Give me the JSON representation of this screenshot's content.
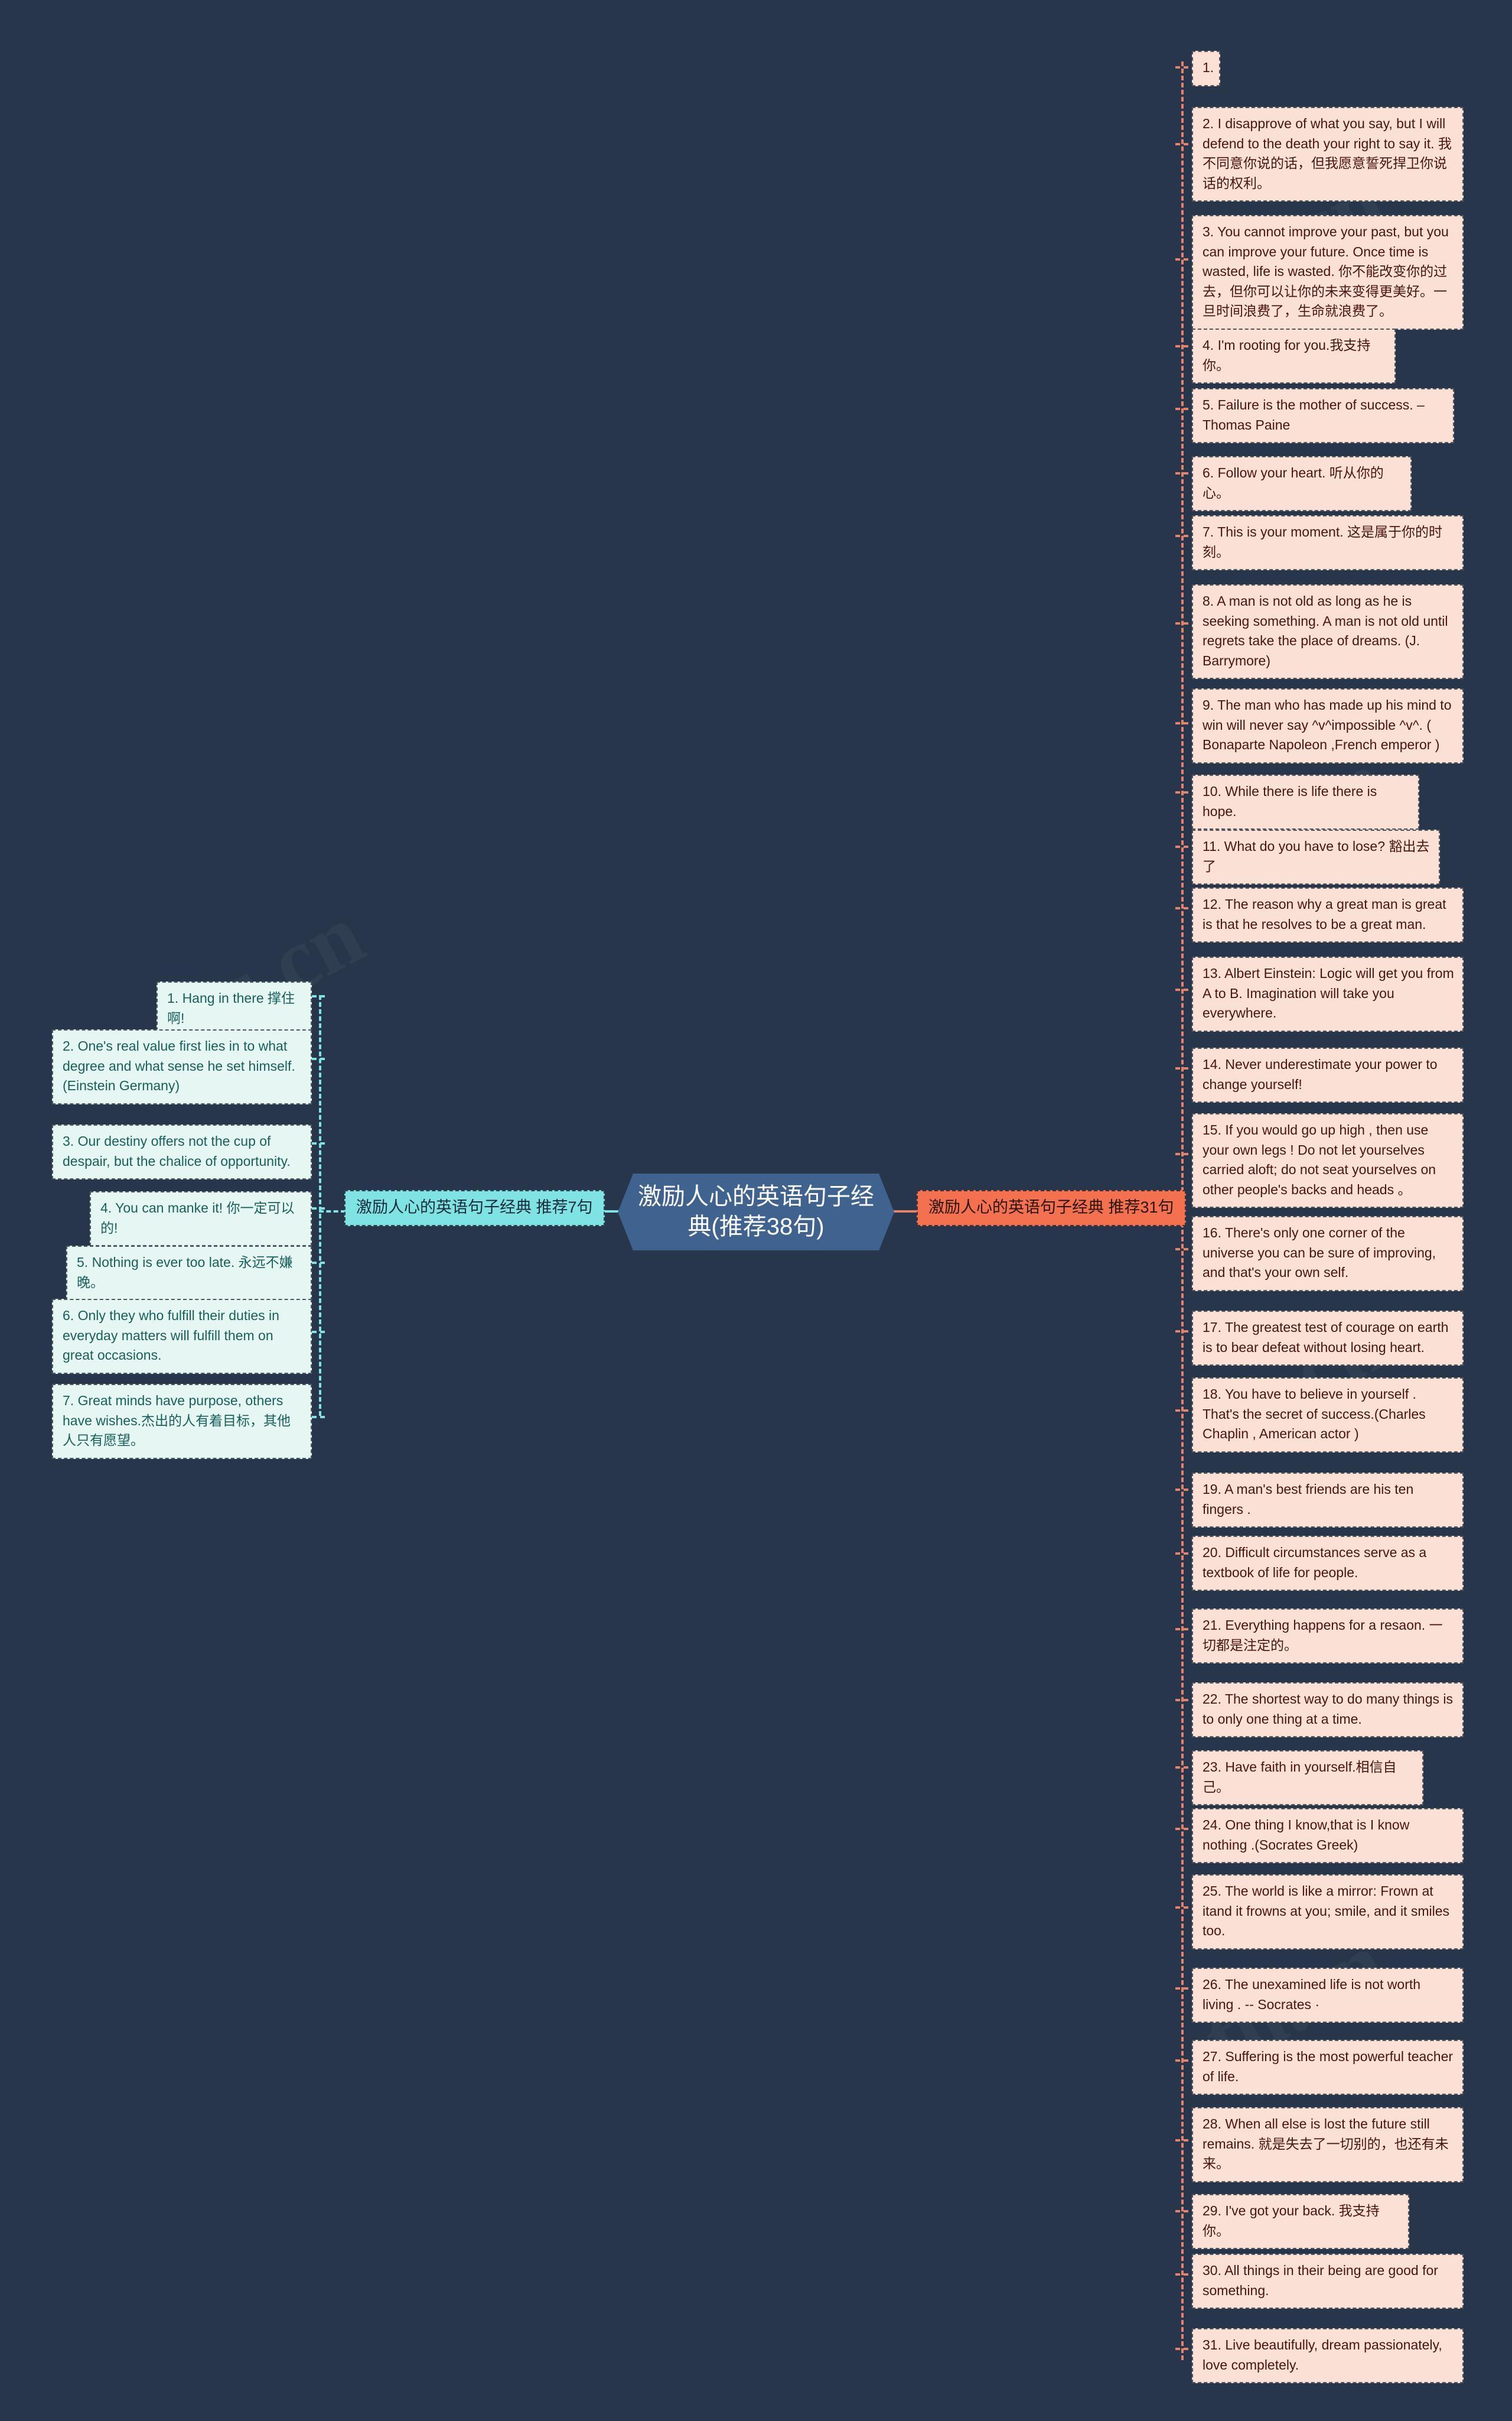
{
  "theme": {
    "canvas_bg": "#27364b",
    "root_bg": "#40628f",
    "root_text": "#ffffff",
    "left_branch_bg": "#7fe3e3",
    "right_branch_bg": "#f4714f",
    "left_leaf_bg": "#e6f7f3",
    "left_leaf_text": "#18605c",
    "right_leaf_bg": "#fbe0d5",
    "right_leaf_text": "#4a1412",
    "left_line": "#7fe3e3",
    "right_line": "#e4836c"
  },
  "root": {
    "label": "激励人心的英语句子经典(推荐38句)"
  },
  "branches": [
    {
      "side": "left",
      "label": "激励人心的英语句子经典 推荐7句",
      "leaves": [
        {
          "text": "1. Hang in there 撑住啊!"
        },
        {
          "text": "2. One's real value first lies in to what degree and what sense he set himself.(Einstein Germany)"
        },
        {
          "text": "3. Our destiny offers not the cup of despair, but the chalice of opportunity."
        },
        {
          "text": "4. You can manke it! 你一定可以的!"
        },
        {
          "text": "5. Nothing is ever too late. 永远不嫌晚。"
        },
        {
          "text": "6. Only they who fulfill their duties in everyday matters will fulfill them on great occasions."
        },
        {
          "text": "7. Great minds have purpose, others have wishes.杰出的人有着目标，其他人只有愿望。"
        }
      ]
    },
    {
      "side": "right",
      "label": "激励人心的英语句子经典 推荐31句",
      "leaves": [
        {
          "text": "1."
        },
        {
          "text": "2. I disapprove of what you say, but I will defend to the death your right to say it. 我不同意你说的话，但我愿意誓死捍卫你说话的权利。"
        },
        {
          "text": "3. You cannot improve your past, but you can improve your future. Once time is wasted, life is wasted. 你不能改变你的过去，但你可以让你的未来变得更美好。一旦时间浪费了，生命就浪费了。"
        },
        {
          "text": "4. I'm rooting for you.我支持你。"
        },
        {
          "text": "5. Failure is the mother of success. – Thomas Paine"
        },
        {
          "text": "6. Follow your heart. 听从你的心。"
        },
        {
          "text": "7. This is your moment. 这是属于你的时刻。"
        },
        {
          "text": "8. A man is not old as long as he is seeking something. A man is not old until regrets take the place of dreams. (J. Barrymore)"
        },
        {
          "text": "9. The man who has made up his mind to win will never say ^v^impossible ^v^. ( Bonaparte Napoleon ,French emperor )"
        },
        {
          "text": "10. While there is life there is hope."
        },
        {
          "text": "11. What do you have to lose? 豁出去了"
        },
        {
          "text": "12. The reason why a great man is great is  that he resolves to be a great man."
        },
        {
          "text": "13. Albert Einstein: Logic will get you from A to B. Imagination will take you everywhere."
        },
        {
          "text": "14. Never underestimate your power to change yourself!"
        },
        {
          "text": "15. If you would go up high , then use your own legs ! Do not let yourselves carried aloft; do not seat yourselves on other people's backs and heads 。"
        },
        {
          "text": "16. There's only one corner of the universe you can be sure of improving, and that's your own self."
        },
        {
          "text": "17. The greatest test of courage on earth is to bear defeat without losing heart."
        },
        {
          "text": "18. You have to believe in yourself . That's the secret of success.(Charles Chaplin , American actor )"
        },
        {
          "text": "19. A man's best friends are his ten fingers ."
        },
        {
          "text": "20. Difficult circumstances serve as a textbook of life for people."
        },
        {
          "text": "21. Everything happens for a resaon. 一切都是注定的。"
        },
        {
          "text": "22. The shortest way to do many things is to only one thing at a time."
        },
        {
          "text": "23. Have faith in yourself.相信自己。"
        },
        {
          "text": "24. One thing I know,that is I know nothing .(Socrates Greek)"
        },
        {
          "text": "25. The world is like a mirror: Frown at itand it frowns at you; smile, and it smiles too."
        },
        {
          "text": "26. The unexamined life is not worth living . -- Socrates ·"
        },
        {
          "text": "27. Suffering is the most powerful teacher  of life."
        },
        {
          "text": "28. When all else is lost the future still remains. 就是失去了一切别的，也还有未来。"
        },
        {
          "text": "29. I've got your back. 我支持你。"
        },
        {
          "text": "30. All things in their being are good for something."
        },
        {
          "text": "31. Live beautifully, dream passionately, love completely."
        }
      ]
    }
  ],
  "watermarks": [
    {
      "text": "tu.cn"
    },
    {
      "text": "tu.cn"
    },
    {
      "text": "tu.cn"
    },
    {
      "text": "tu.cn"
    },
    {
      "text": "tu.cn"
    }
  ]
}
